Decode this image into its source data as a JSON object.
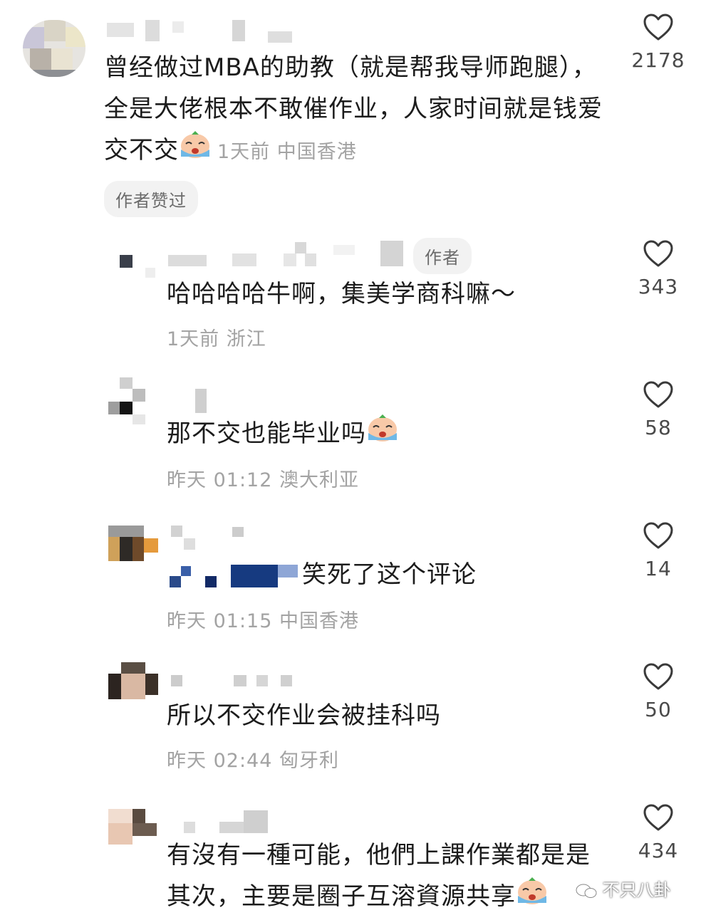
{
  "comments": [
    {
      "text": "曾经做过MBA的助教（就是帮我导师跑腿），全是大佬根本不敢催作业，人家时间就是钱爱交不交",
      "meta": "1天前 中国香港",
      "likes": "2178",
      "badge": "作者赞过"
    },
    {
      "author_tag": "作者",
      "text": "哈哈哈哈牛啊，集美学商科嘛～",
      "meta": "1天前 浙江",
      "likes": "343"
    },
    {
      "text": "那不交也能毕业吗",
      "meta": "昨天 01:12 澳大利亚",
      "likes": "58"
    },
    {
      "text": "笑死了这个评论",
      "meta": "昨天 01:15 中国香港",
      "likes": "14"
    },
    {
      "text": "所以不交作业会被挂科吗",
      "meta": "昨天 02:44 匈牙利",
      "likes": "50"
    },
    {
      "text": "有沒有一種可能，他們上課作業都是是其次，主要是圈子互溶資源共享",
      "likes": "434"
    }
  ],
  "watermark": "不只八卦",
  "icons": {
    "like": "heart-outline-icon",
    "emoji": "crying-face-emoji"
  }
}
